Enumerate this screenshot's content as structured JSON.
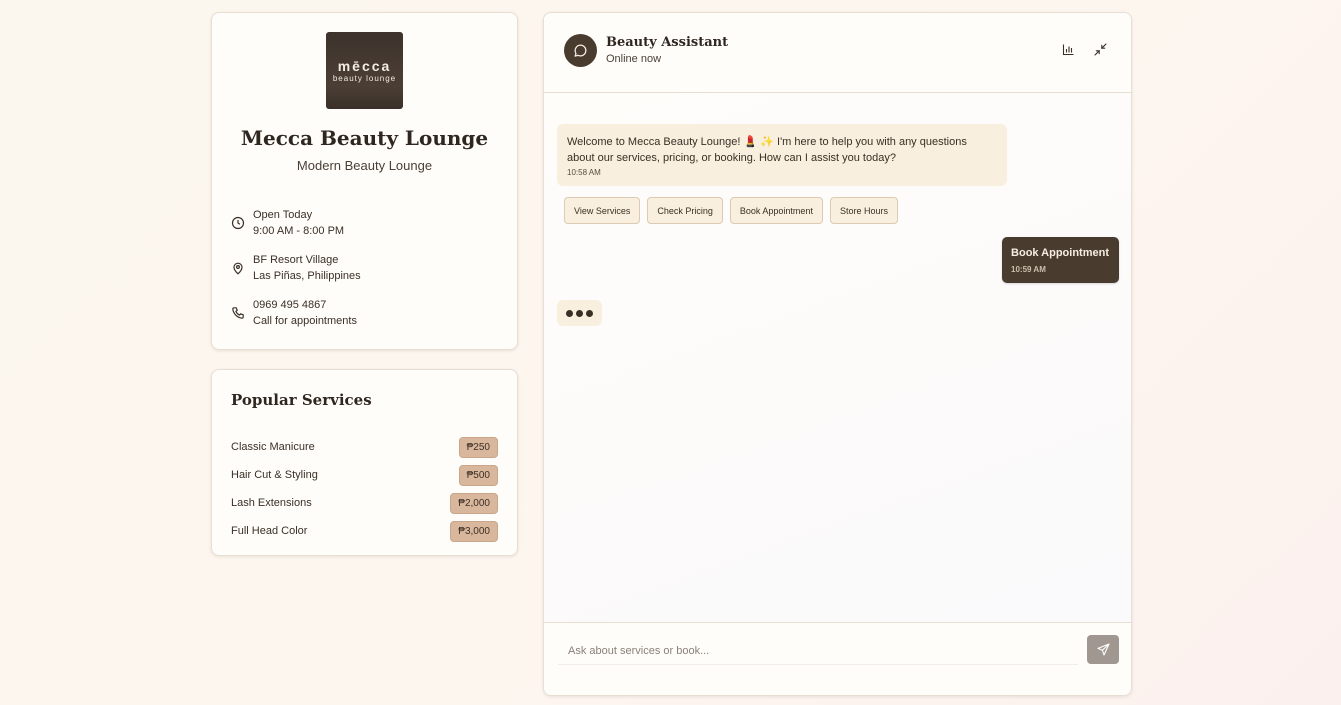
{
  "business": {
    "logo_word": "mēcca",
    "logo_sub": "beauty lounge",
    "name": "Mecca Beauty Lounge",
    "tagline": "Modern Beauty Lounge",
    "hours": {
      "icon": "clock-icon",
      "title": "Open Today",
      "detail": "9:00 AM - 8:00 PM"
    },
    "location": {
      "icon": "map-pin-icon",
      "title": "BF Resort Village",
      "detail": "Las Piñas, Philippines"
    },
    "phone": {
      "icon": "phone-icon",
      "title": "0969 495 4867",
      "detail": "Call for appointments"
    }
  },
  "services": {
    "title": "Popular Services",
    "items": [
      {
        "name": "Classic Manicure",
        "price": "₱250"
      },
      {
        "name": "Hair Cut & Styling",
        "price": "₱500"
      },
      {
        "name": "Lash Extensions",
        "price": "₱2,000"
      },
      {
        "name": "Full Head Color",
        "price": "₱3,000"
      }
    ]
  },
  "chat": {
    "assistant_name": "Beauty Assistant",
    "status": "Online now",
    "header_icons": [
      "chart-icon",
      "minimize-icon"
    ],
    "messages": [
      {
        "from": "bot",
        "text": "Welcome to Mecca Beauty Lounge! 💄 ✨ I'm here to help you with any questions about our services, pricing, or booking. How can I assist you today?",
        "time": "10:58 AM"
      },
      {
        "from": "user",
        "text": "Book Appointment",
        "time": "10:59 AM"
      }
    ],
    "quick_replies": [
      "View Services",
      "Check Pricing",
      "Book Appointment",
      "Store Hours"
    ],
    "input_placeholder": "Ask about services or book...",
    "input_value": ""
  },
  "colors": {
    "brand_dark": "#4a3b2f",
    "bubble_bg": "#f8efde",
    "price_badge": "#d8b79d",
    "send_disabled": "#a09890"
  }
}
